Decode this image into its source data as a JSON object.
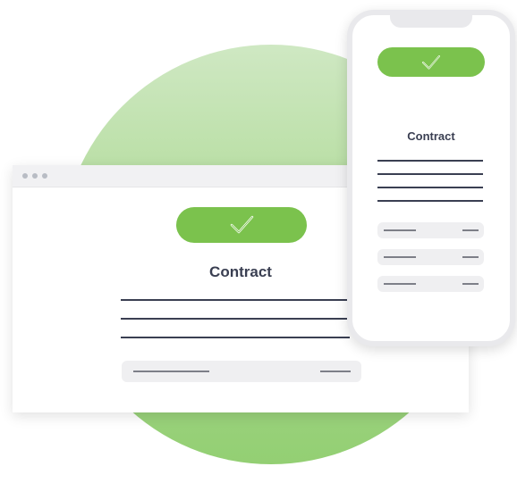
{
  "browser": {
    "title": "Contract",
    "status": "approved"
  },
  "phone": {
    "title": "Contract",
    "status": "approved"
  },
  "colors": {
    "accent_green": "#7bc24d",
    "circle_green": "#a9d88e",
    "text_dark": "#3a3f52"
  },
  "icons": {
    "status": "checkmark-icon"
  }
}
